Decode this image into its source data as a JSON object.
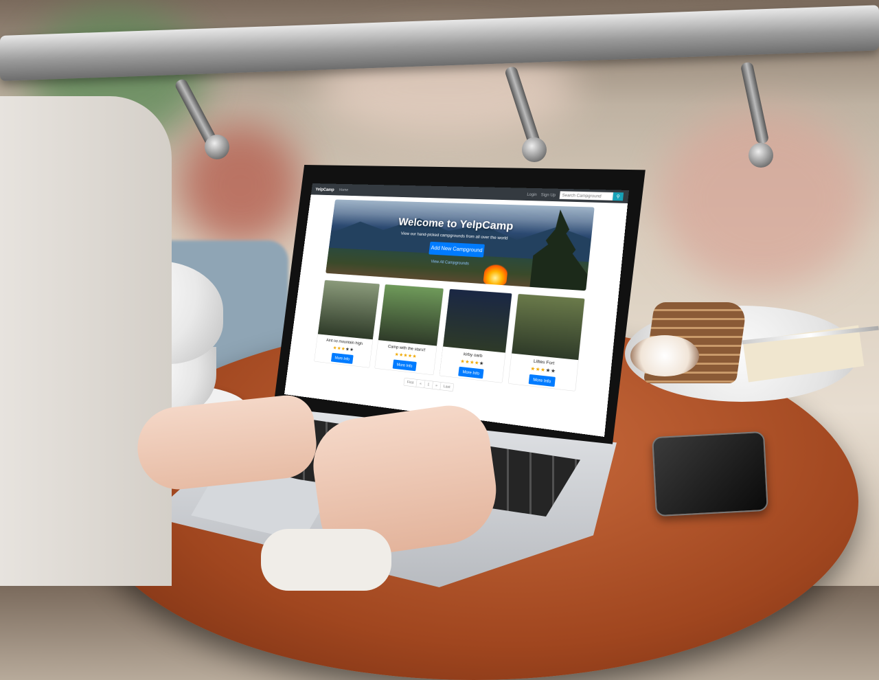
{
  "navbar": {
    "brand": "YelpCamp",
    "home": "Home",
    "login": "Login",
    "signup": "Sign Up",
    "search_placeholder": "Search Campground",
    "search_icon": "search-icon"
  },
  "hero": {
    "title": "Welcome to YelpCamp",
    "subtitle": "View our hand-picked campgrounds from all over the world",
    "add_button": "Add New Campground",
    "view_all_link": "View All Campgrounds"
  },
  "campgrounds": [
    {
      "name": "Aint no mountain high",
      "rating": 3,
      "button": "More Info",
      "color": "#8a9a7a"
    },
    {
      "name": "Camp with the stars!!",
      "rating": 5,
      "button": "More Info",
      "color": "#6f9a5a"
    },
    {
      "name": "kirby oarb",
      "rating": 4,
      "button": "More Info",
      "color": "#1a2744"
    },
    {
      "name": "Lillies Fort",
      "rating": 3,
      "button": "More Info",
      "color": "#6a7a4a"
    }
  ],
  "pagination": {
    "first": "First",
    "prev": "«",
    "page": "1",
    "next": "»",
    "last": "Last"
  },
  "colors": {
    "navbar": "#343a40",
    "primary": "#007bff",
    "search_button": "#17a2b8",
    "star": "#f0a800"
  }
}
